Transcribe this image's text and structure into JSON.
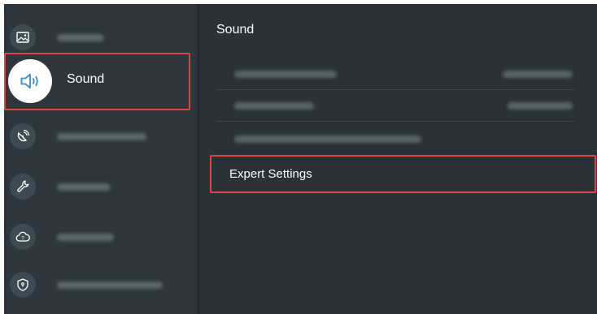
{
  "sidebar": {
    "items": [
      {
        "name": "picture",
        "icon": "picture-icon"
      },
      {
        "name": "sound",
        "icon": "speaker-icon",
        "label": "Sound",
        "selected": true
      },
      {
        "name": "broadcasting",
        "icon": "satellite-dish-icon"
      },
      {
        "name": "general",
        "icon": "wrench-icon"
      },
      {
        "name": "support",
        "icon": "help-cloud-icon"
      },
      {
        "name": "privacy",
        "icon": "shield-icon"
      }
    ]
  },
  "main": {
    "title": "Sound",
    "highlighted_item": "Expert Settings"
  },
  "colors": {
    "background": "#283238",
    "sidebar": "#2c363c",
    "highlight_border": "#e0423e",
    "text": "#ffffff"
  }
}
